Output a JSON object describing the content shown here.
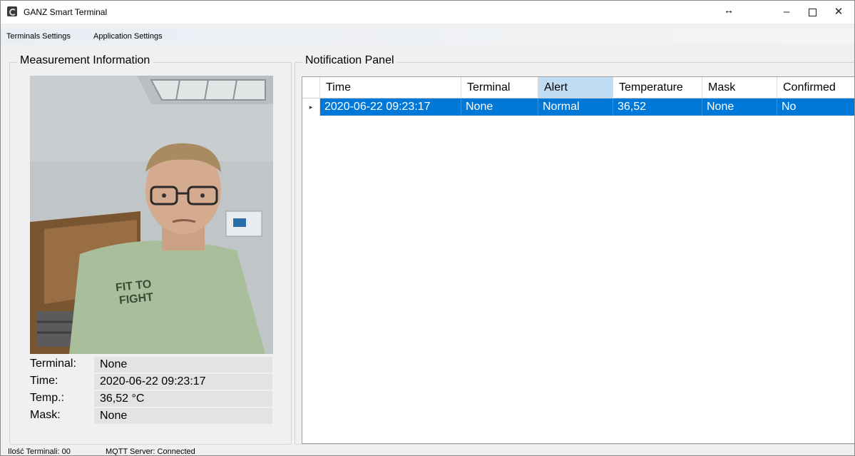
{
  "window": {
    "title": "GANZ Smart Terminal",
    "resize_glyph": "↔",
    "minimize_glyph": "–",
    "close_glyph": "✕"
  },
  "menu": {
    "items": [
      "Terminals Settings",
      "Application Settings"
    ]
  },
  "measurement": {
    "title": "Measurement Information",
    "camera_icon": "camera-feed-image",
    "rows": [
      {
        "label": "Terminal:",
        "value": "None"
      },
      {
        "label": "Time:",
        "value": "2020-06-22 09:23:17"
      },
      {
        "label": "Temp.:",
        "value": "36,52 °C"
      },
      {
        "label": "Mask:",
        "value": "None"
      }
    ]
  },
  "notifications": {
    "title": "Notification Panel",
    "columns": [
      "Time",
      "Terminal",
      "Alert",
      "Temperature",
      "Mask",
      "Confirmed"
    ],
    "selected_column": "Alert",
    "rows": [
      {
        "time": "2020-06-22 09:23:17",
        "terminal": "None",
        "alert": "Normal",
        "temperature": "36,52",
        "mask": "None",
        "confirmed": "No"
      }
    ],
    "row_indicator": "▸"
  },
  "status": {
    "terminals": "Ilość Terminali: 00",
    "mqtt": "MQTT Server: Connected"
  },
  "colors": {
    "selection": "#0078d7",
    "header_selected": "#bfdcf3"
  }
}
